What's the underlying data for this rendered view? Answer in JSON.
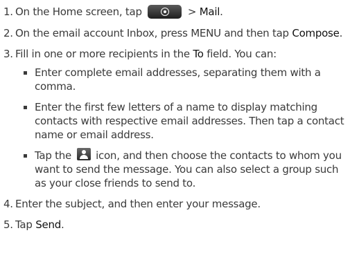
{
  "steps": [
    {
      "num": "1.",
      "pre": "On the Home screen, tap",
      "post": "> ",
      "bold": "Mail",
      "end": "."
    },
    {
      "num": "2.",
      "text": "On the email account Inbox, press MENU and then tap",
      "bold": "Compose",
      "end": "."
    },
    {
      "num": "3.",
      "pre": "Fill in one or more recipients in the",
      "bold": "To",
      "post": "field. You can:"
    },
    {
      "num": "4.",
      "text": "Enter the subject, and then enter your message."
    },
    {
      "num": "5.",
      "pre": "Tap",
      "bold": "Send",
      "end": "."
    }
  ],
  "bullets": {
    "b1": "Enter complete email addresses, separating them with a comma.",
    "b2": "Enter the first few letters of a name to display matching contacts with respective email addresses. Then tap a contact name or email address.",
    "b3_pre": "Tap the",
    "b3_post": "icon, and then choose the contacts to whom you want to send the message. You can also select a group such as your close friends to send to."
  },
  "icons": {
    "home_button": "home-button-icon",
    "contact": "contact-person-icon"
  }
}
